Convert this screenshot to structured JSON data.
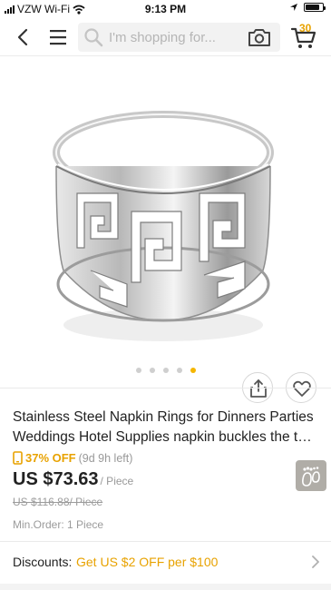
{
  "status_bar": {
    "carrier": "VZW Wi-Fi",
    "time": "9:13 PM"
  },
  "search": {
    "placeholder": "I'm shopping for..."
  },
  "cart": {
    "count": "30"
  },
  "gallery": {
    "image_count": 5,
    "active_index": 4
  },
  "product": {
    "title": "Stainless Steel Napkin Rings for Dinners Parties Weddings Hotel Supplies napkin buckles the t…",
    "discount": "37% OFF",
    "timer": "(9d 9h left)",
    "price": "US $73.63",
    "price_unit": "/ Piece",
    "old_price": "US $116.88/ Piece",
    "min_order": "Min.Order: 1  Piece"
  },
  "discounts": {
    "label": "Discounts:",
    "value": "Get US $2 OFF per $100"
  },
  "colors": {
    "accent": "#e8a200",
    "dot_active": "#f5b600"
  }
}
